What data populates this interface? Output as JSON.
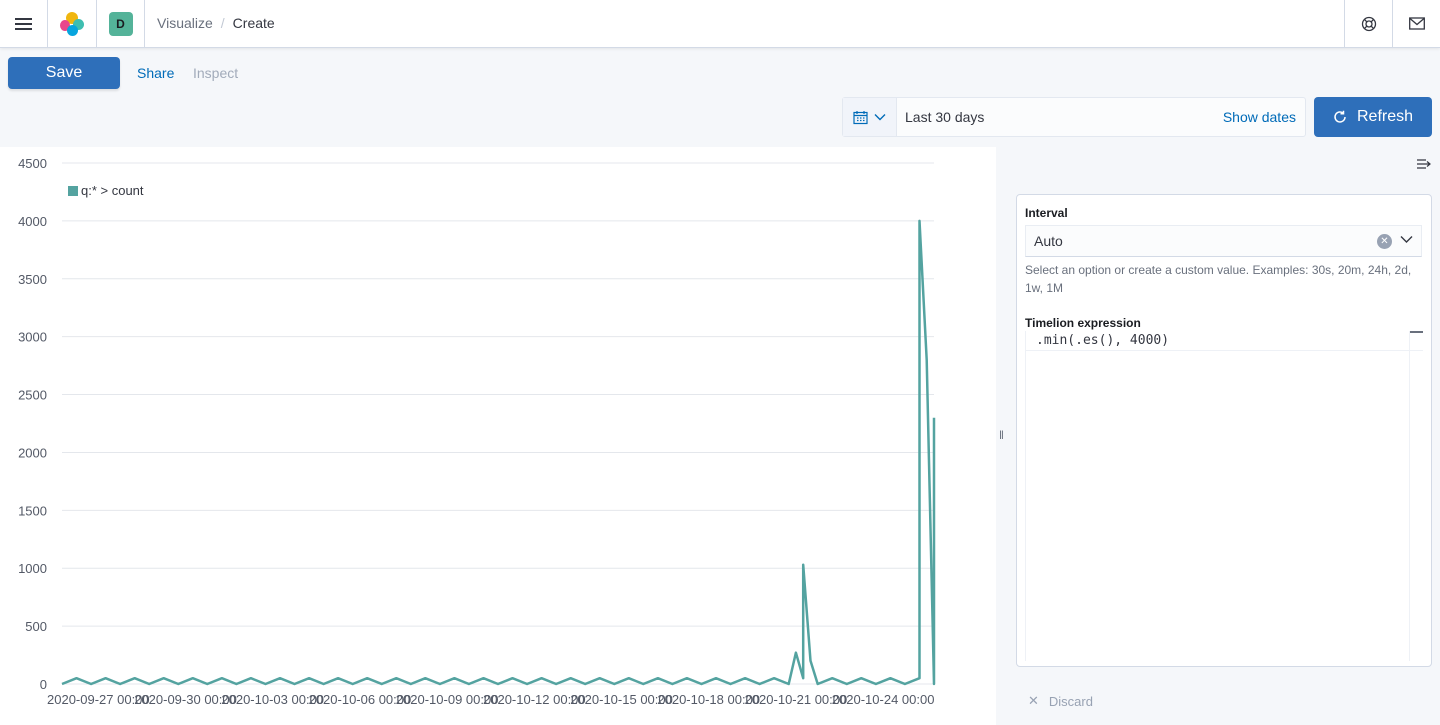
{
  "header": {
    "workspace_initial": "D",
    "breadcrumbs": [
      "Visualize",
      "Create"
    ]
  },
  "toolbar": {
    "save_label": "Save",
    "share_label": "Share",
    "inspect_label": "Inspect"
  },
  "date_picker": {
    "value": "Last 30 days",
    "show_dates_label": "Show dates",
    "refresh_label": "Refresh"
  },
  "sidebar": {
    "interval_label": "Interval",
    "interval_value": "Auto",
    "interval_help": "Select an option or create a custom value. Examples: 30s, 20m, 24h, 2d, 1w, 1M",
    "expression_label": "Timelion expression",
    "expression_value": ".min(.es(), 4000)",
    "discard_label": "Discard"
  },
  "colors": {
    "accent": "#2e6fba",
    "series": "#54a3a0",
    "link": "#006bb8"
  },
  "chart_data": {
    "type": "line",
    "legend": [
      "q:* > count"
    ],
    "ylim": [
      0,
      4500
    ],
    "yticks": [
      0,
      500,
      1000,
      1500,
      2000,
      2500,
      3000,
      3500,
      4000,
      4500
    ],
    "xticks": [
      "2020-09-27 00:00",
      "2020-09-30 00:00",
      "2020-10-03 00:00",
      "2020-10-06 00:00",
      "2020-10-09 00:00",
      "2020-10-12 00:00",
      "2020-10-15 00:00",
      "2020-10-18 00:00",
      "2020-10-21 00:00",
      "2020-10-24 00:00"
    ],
    "series": [
      {
        "name": "q:* > count",
        "baseline_wave": {
          "min": 0,
          "max": 50,
          "points_per_day": 1
        },
        "peaks": [
          {
            "x": "2020-10-21 06:00",
            "y": 1030
          },
          {
            "x": "2020-10-21 00:00",
            "y": 270
          },
          {
            "x": "2020-10-21 12:00",
            "y": 200
          },
          {
            "x": "2020-10-25 06:00",
            "y": 4000
          },
          {
            "x": "2020-10-25 12:00",
            "y": 2800
          },
          {
            "x": "2020-10-25 18:00",
            "y": 2300
          }
        ]
      }
    ],
    "grid": true
  }
}
